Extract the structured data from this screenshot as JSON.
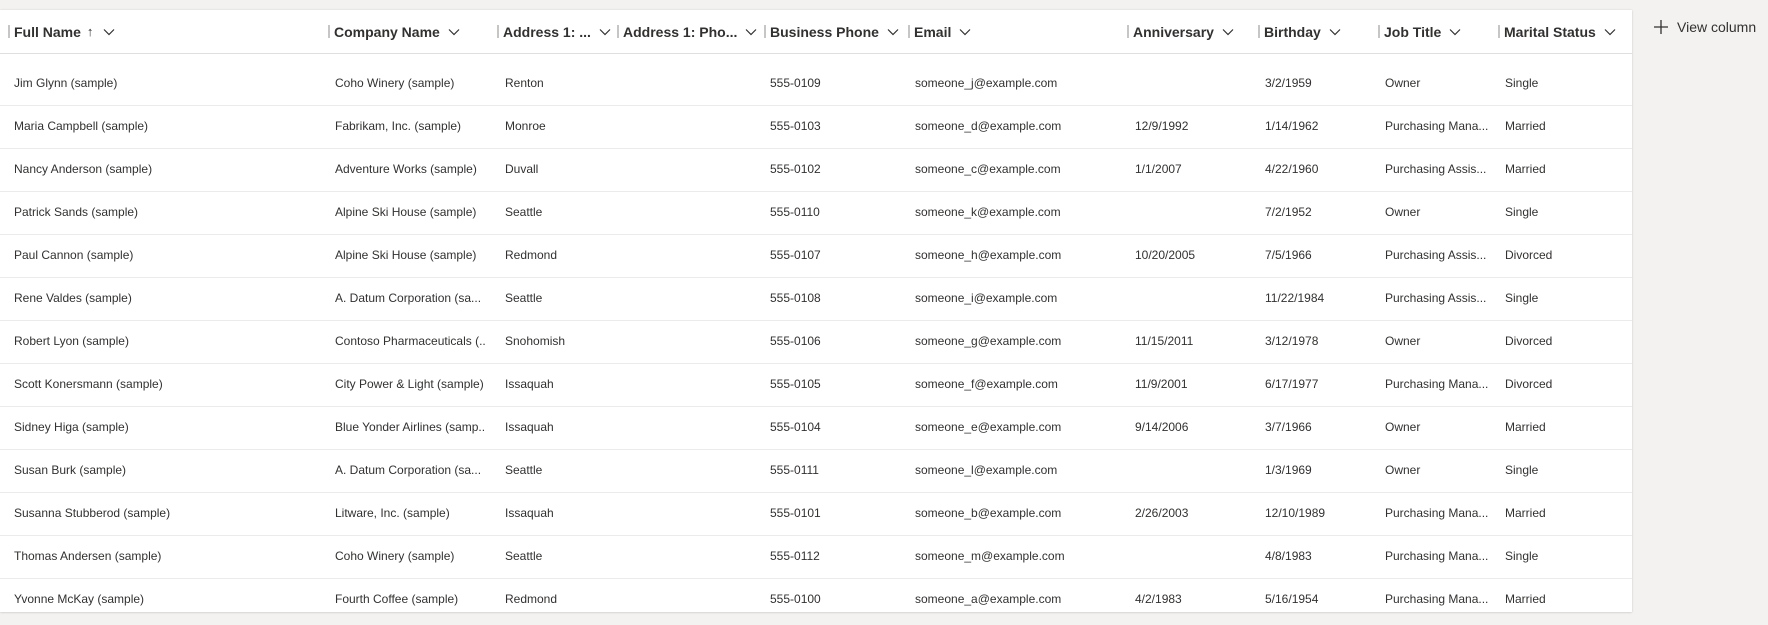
{
  "toolbar": {
    "view_column_label": "View column",
    "view_column_icon": "add-icon"
  },
  "columns": [
    {
      "key": "full_name",
      "label": "Full Name",
      "sorted": "ascending",
      "sort_icon": "arrow-up-icon"
    },
    {
      "key": "company",
      "label": "Company Name"
    },
    {
      "key": "address_city",
      "label": "Address 1: ..."
    },
    {
      "key": "address_phone",
      "label": "Address 1: Pho..."
    },
    {
      "key": "business_phone",
      "label": "Business Phone"
    },
    {
      "key": "email",
      "label": "Email"
    },
    {
      "key": "anniversary",
      "label": "Anniversary"
    },
    {
      "key": "birthday",
      "label": "Birthday"
    },
    {
      "key": "job_title",
      "label": "Job Title"
    },
    {
      "key": "marital_status",
      "label": "Marital Status"
    }
  ],
  "rows": [
    {
      "full_name": "Jim Glynn (sample)",
      "company": "Coho Winery (sample)",
      "address_city": "Renton",
      "address_phone": "",
      "business_phone": "555-0109",
      "email": "someone_j@example.com",
      "anniversary": "",
      "birthday": "3/2/1959",
      "job_title": "Owner",
      "marital_status": "Single"
    },
    {
      "full_name": "Maria Campbell (sample)",
      "company": "Fabrikam, Inc. (sample)",
      "address_city": "Monroe",
      "address_phone": "",
      "business_phone": "555-0103",
      "email": "someone_d@example.com",
      "anniversary": "12/9/1992",
      "birthday": "1/14/1962",
      "job_title": "Purchasing Mana...",
      "marital_status": "Married"
    },
    {
      "full_name": "Nancy Anderson (sample)",
      "company": "Adventure Works (sample)",
      "address_city": "Duvall",
      "address_phone": "",
      "business_phone": "555-0102",
      "email": "someone_c@example.com",
      "anniversary": "1/1/2007",
      "birthday": "4/22/1960",
      "job_title": "Purchasing Assis...",
      "marital_status": "Married"
    },
    {
      "full_name": "Patrick Sands (sample)",
      "company": "Alpine Ski House (sample)",
      "address_city": "Seattle",
      "address_phone": "",
      "business_phone": "555-0110",
      "email": "someone_k@example.com",
      "anniversary": "",
      "birthday": "7/2/1952",
      "job_title": "Owner",
      "marital_status": "Single"
    },
    {
      "full_name": "Paul Cannon (sample)",
      "company": "Alpine Ski House (sample)",
      "address_city": "Redmond",
      "address_phone": "",
      "business_phone": "555-0107",
      "email": "someone_h@example.com",
      "anniversary": "10/20/2005",
      "birthday": "7/5/1966",
      "job_title": "Purchasing Assis...",
      "marital_status": "Divorced"
    },
    {
      "full_name": "Rene Valdes (sample)",
      "company": "A. Datum Corporation (sa...",
      "address_city": "Seattle",
      "address_phone": "",
      "business_phone": "555-0108",
      "email": "someone_i@example.com",
      "anniversary": "",
      "birthday": "11/22/1984",
      "job_title": "Purchasing Assis...",
      "marital_status": "Single"
    },
    {
      "full_name": "Robert Lyon (sample)",
      "company": "Contoso Pharmaceuticals (...",
      "address_city": "Snohomish",
      "address_phone": "",
      "business_phone": "555-0106",
      "email": "someone_g@example.com",
      "anniversary": "11/15/2011",
      "birthday": "3/12/1978",
      "job_title": "Owner",
      "marital_status": "Divorced"
    },
    {
      "full_name": "Scott Konersmann (sample)",
      "company": "City Power & Light (sample)",
      "address_city": "Issaquah",
      "address_phone": "",
      "business_phone": "555-0105",
      "email": "someone_f@example.com",
      "anniversary": "11/9/2001",
      "birthday": "6/17/1977",
      "job_title": "Purchasing Mana...",
      "marital_status": "Divorced"
    },
    {
      "full_name": "Sidney Higa (sample)",
      "company": "Blue Yonder Airlines (samp...",
      "address_city": "Issaquah",
      "address_phone": "",
      "business_phone": "555-0104",
      "email": "someone_e@example.com",
      "anniversary": "9/14/2006",
      "birthday": "3/7/1966",
      "job_title": "Owner",
      "marital_status": "Married"
    },
    {
      "full_name": "Susan Burk (sample)",
      "company": "A. Datum Corporation (sa...",
      "address_city": "Seattle",
      "address_phone": "",
      "business_phone": "555-0111",
      "email": "someone_l@example.com",
      "anniversary": "",
      "birthday": "1/3/1969",
      "job_title": "Owner",
      "marital_status": "Single"
    },
    {
      "full_name": "Susanna Stubberod (sample)",
      "company": "Litware, Inc. (sample)",
      "address_city": "Issaquah",
      "address_phone": "",
      "business_phone": "555-0101",
      "email": "someone_b@example.com",
      "anniversary": "2/26/2003",
      "birthday": "12/10/1989",
      "job_title": "Purchasing Mana...",
      "marital_status": "Married"
    },
    {
      "full_name": "Thomas Andersen (sample)",
      "company": "Coho Winery (sample)",
      "address_city": "Seattle",
      "address_phone": "",
      "business_phone": "555-0112",
      "email": "someone_m@example.com",
      "anniversary": "",
      "birthday": "4/8/1983",
      "job_title": "Purchasing Mana...",
      "marital_status": "Single"
    },
    {
      "full_name": "Yvonne McKay (sample)",
      "company": "Fourth Coffee (sample)",
      "address_city": "Redmond",
      "address_phone": "",
      "business_phone": "555-0100",
      "email": "someone_a@example.com",
      "anniversary": "4/2/1983",
      "birthday": "5/16/1954",
      "job_title": "Purchasing Mana...",
      "marital_status": "Married"
    }
  ]
}
